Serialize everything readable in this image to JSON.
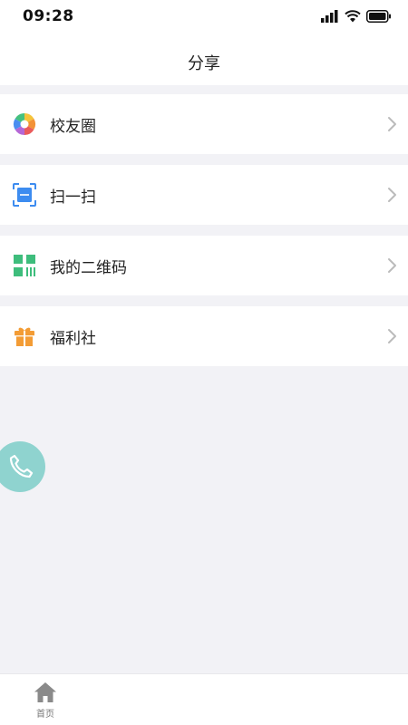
{
  "status_bar": {
    "time": "09:28"
  },
  "header": {
    "title": "分享"
  },
  "menu": {
    "items": [
      {
        "label": "校友圈",
        "icon": "colorful-aperture-icon"
      },
      {
        "label": "扫一扫",
        "icon": "scan-icon"
      },
      {
        "label": "我的二维码",
        "icon": "qr-code-icon"
      },
      {
        "label": "福利社",
        "icon": "gift-icon"
      }
    ]
  },
  "tab_bar": {
    "items": [
      {
        "label": "首页",
        "icon": "home-icon"
      }
    ]
  },
  "colors": {
    "background": "#f2f2f6",
    "surface": "#ffffff",
    "fab": "#8fd3cf",
    "scan_blue": "#3d8cf0",
    "qr_green": "#3ebd7c",
    "gift_orange": "#f39c35",
    "chevron": "#bbbbbb"
  }
}
